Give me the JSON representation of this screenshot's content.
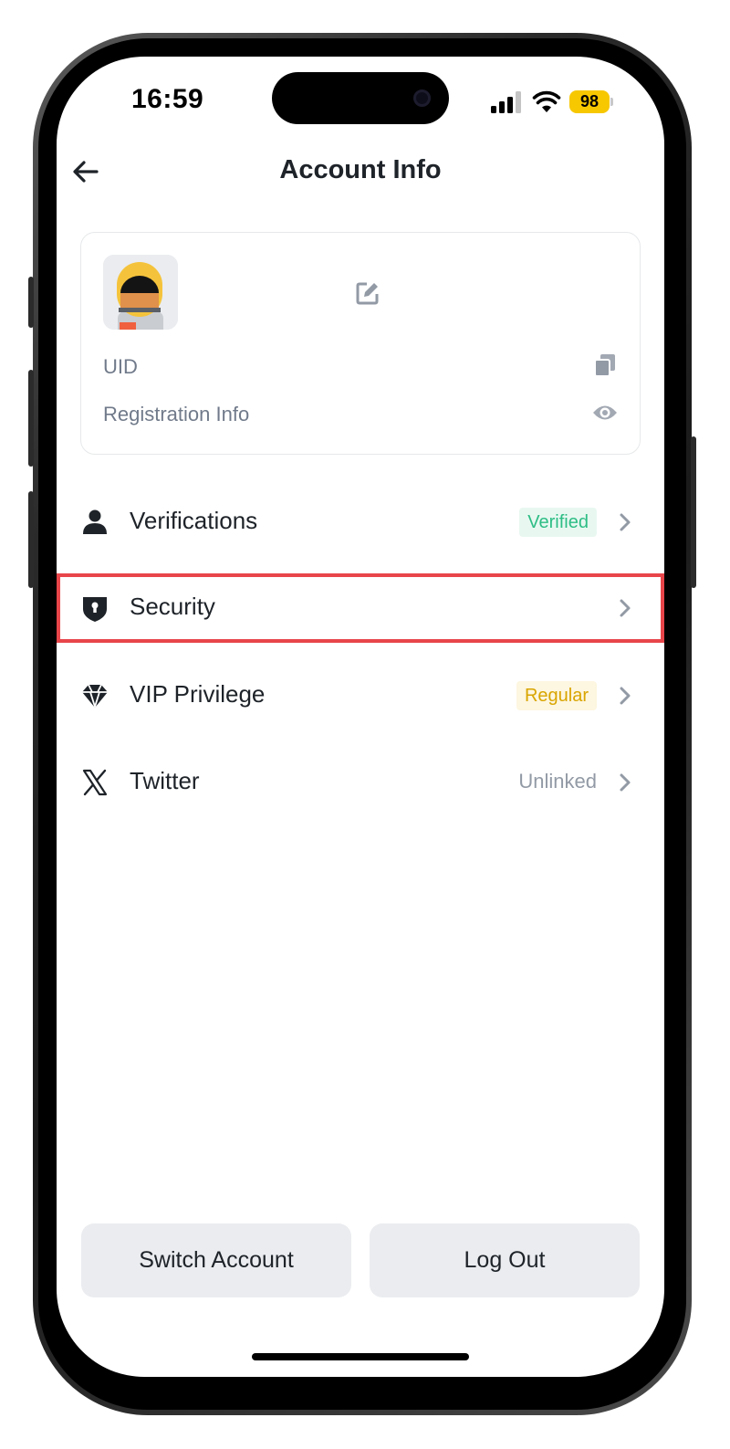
{
  "status_bar": {
    "time": "16:59",
    "battery": "98"
  },
  "header": {
    "title": "Account Info"
  },
  "profile": {
    "uid_label": "UID",
    "registration_label": "Registration Info"
  },
  "menu": [
    {
      "label": "Verifications",
      "status": "Verified",
      "status_style": "green-badge",
      "icon": "person-icon"
    },
    {
      "label": "Security",
      "status": "",
      "icon": "shield-icon",
      "highlighted": true
    },
    {
      "label": "VIP Privilege",
      "status": "Regular",
      "status_style": "yellow-badge",
      "icon": "diamond-icon"
    },
    {
      "label": "Twitter",
      "status": "Unlinked",
      "status_style": "plain-text",
      "icon": "x-logo-icon"
    }
  ],
  "buttons": {
    "switch_account": "Switch Account",
    "log_out": "Log Out"
  },
  "colors": {
    "highlight_border": "#e8454a",
    "verified_green": "#2ebd85",
    "regular_yellow": "#d9a500",
    "battery_yellow": "#f7c700",
    "button_bg": "#eaecef"
  }
}
